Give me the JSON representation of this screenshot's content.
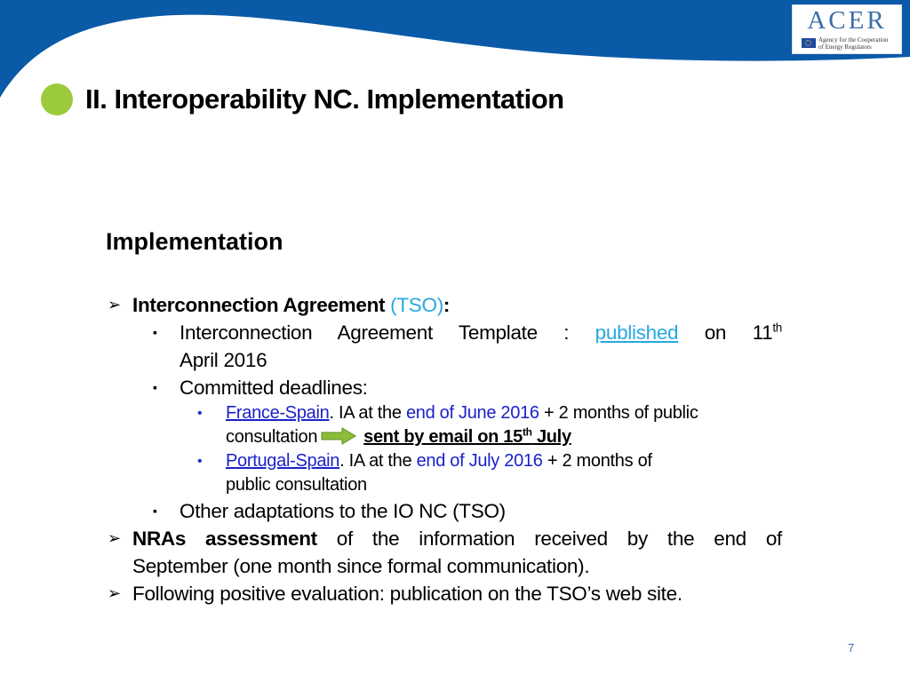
{
  "header": {
    "banner_color": "#0a5aa8",
    "logo": {
      "title": "ACER",
      "subtitle_line1": "Agency for the Cooperation",
      "subtitle_line2": "of Energy Regulators"
    },
    "title": "II. Interoperability NC. Implementation",
    "title_dot_color": "#9bcb3c"
  },
  "section": {
    "heading": "Implementation"
  },
  "content": {
    "item1": {
      "bold": "Interconnection Agreement",
      "tso": "(TSO)",
      "colon": ":",
      "sub1": {
        "text_a": "Interconnection Agreement Template : ",
        "link": "published",
        "text_b": " on 11",
        "sup": "th",
        "text_c": "April 2016"
      },
      "sub2": {
        "text": "Committed deadlines:",
        "deadlines": [
          {
            "link": "France-Spain",
            "text_a": ". IA at the ",
            "date": "end of June 2016",
            "text_b": " + 2 months of public",
            "text_c": "consultation",
            "note_a": "sent by email on 15",
            "note_sup": "th",
            "note_b": " July"
          },
          {
            "link": "Portugal-Spain",
            "text_a": ". IA at the ",
            "date": "end of July 2016",
            "text_b": " + 2 months of",
            "text_c": "public consultation"
          }
        ]
      },
      "sub3": {
        "text": "Other adaptations to the IO NC (TSO)"
      }
    },
    "item2": {
      "bold": "NRAs assessment",
      "text_a": " of the information received by the end of",
      "text_b": "September (one month since formal communication)."
    },
    "item3": {
      "text": "Following positive evaluation: publication on the TSO’s web site."
    },
    "bullets": {
      "level1": "➢",
      "level2": "▪",
      "level3": "•"
    }
  },
  "footer": {
    "page_number": "7"
  }
}
